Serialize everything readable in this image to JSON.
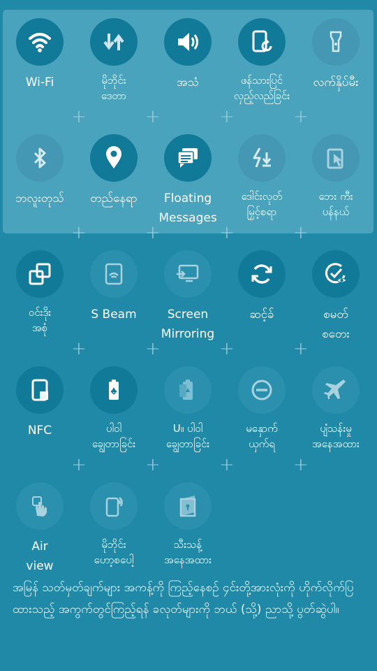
{
  "tiles": [
    {
      "label": "Wi-Fi",
      "icon": "wifi-icon",
      "on": true
    },
    {
      "label": "မိုဘိုင်း\nဒေတာ",
      "icon": "mobile-data-icon",
      "on": true
    },
    {
      "label": "အသံ",
      "icon": "sound-icon",
      "on": true
    },
    {
      "label": "ဖန်သားပြင်\nလှည့်လည်ခြင်း",
      "icon": "screen-rotation-icon",
      "on": true
    },
    {
      "label": "လက်နှိပ်မီး",
      "icon": "flashlight-icon",
      "on": false
    },
    {
      "label": "ဘလူးတုသ်",
      "icon": "bluetooth-icon",
      "on": false
    },
    {
      "label": "တည်နေရာ",
      "icon": "location-icon",
      "on": true
    },
    {
      "label": "Floating\nMessages",
      "icon": "floating-messages-icon",
      "on": true
    },
    {
      "label": "ဒေါင်းလုတ်\nမြှင့်စရာ",
      "icon": "download-booster-icon",
      "on": false
    },
    {
      "label": "ဘေး ကီး\nပန်နယ်",
      "icon": "side-key-panel-icon",
      "on": false
    },
    {
      "label": "ဝင်းဒိုး\nအစုံ",
      "icon": "multi-window-icon",
      "on": true
    },
    {
      "label": "S Beam",
      "icon": "s-beam-icon",
      "on": false
    },
    {
      "label": "Screen\nMirroring",
      "icon": "screen-mirroring-icon",
      "on": false
    },
    {
      "label": "ဆင့်ခ်",
      "icon": "sync-icon",
      "on": true
    },
    {
      "label": "စမတ်\nစတေး",
      "icon": "smart-stay-icon",
      "on": true
    },
    {
      "label": "NFC",
      "icon": "nfc-icon",
      "on": true
    },
    {
      "label": "ပါဝါ\nချွေတာခြင်း",
      "icon": "power-saving-icon",
      "on": true
    },
    {
      "label": "U။ ပါဝါ\nချွေတာခြင်း",
      "icon": "ultra-power-saving-icon",
      "on": false
    },
    {
      "label": "မနှောက်\nယှက်ရ",
      "icon": "do-not-disturb-icon",
      "on": false
    },
    {
      "label": "ပျံသန်းမှု\nအနေအထား",
      "icon": "airplane-mode-icon",
      "on": false
    },
    {
      "label": "Air\nview",
      "icon": "air-view-icon",
      "on": false
    },
    {
      "label": "မိုဘိုင်း\nဟော့စပေါ့",
      "icon": "mobile-hotspot-icon",
      "on": false
    },
    {
      "label": "သီးသန့်\nအနေအထား",
      "icon": "private-mode-icon",
      "on": false
    }
  ],
  "hint": "အမြန် သတ်မှတ်ချက်များ အကန့်ကို ကြည့်နေစဉ် ၄င်းတို့အားလုံးကို ဟိုက်လိုက်ပြထားသည့် အကွက်တွင်ကြည့်ရန် ခလုတ်များကို ဘယ် (သို့) ညာသို့ ပွတ်ဆွဲပါ။",
  "colors": {
    "background": "#2089a8",
    "panel": "#4aa3bd",
    "tile_on": "#127a99",
    "tile_off": "#2b8fae",
    "plus": "#9fd0de"
  }
}
